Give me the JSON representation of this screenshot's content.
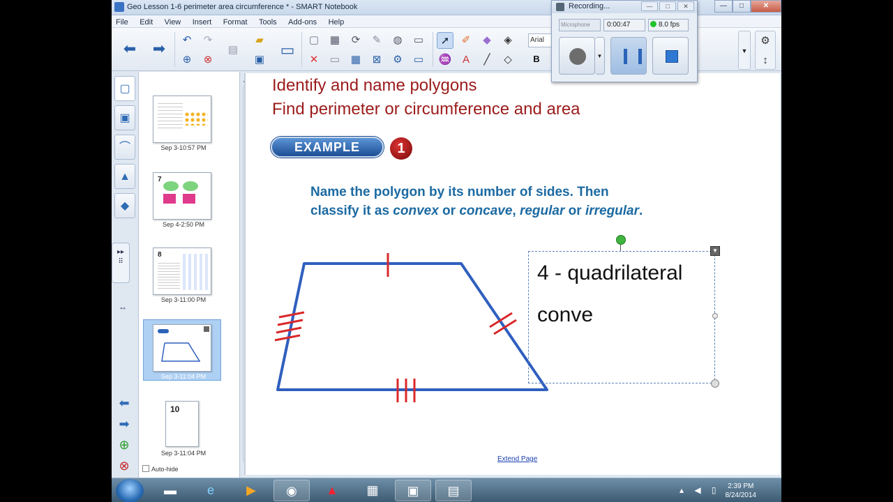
{
  "window": {
    "title": "Geo Lesson 1-6 perimeter area circumference * - SMART Notebook",
    "buttons": [
      "—",
      "□",
      "✕"
    ]
  },
  "menu": [
    "File",
    "Edit",
    "View",
    "Insert",
    "Format",
    "Tools",
    "Add-ons",
    "Help"
  ],
  "toolbar": {
    "font_name": "Arial",
    "bold_label": "B"
  },
  "recorder": {
    "title": "Recording...",
    "source_placeholder": "Microphone",
    "elapsed": "0:00:47",
    "fps": "8.0 fps",
    "buttons": [
      "—",
      "□",
      "✕"
    ]
  },
  "pages": [
    {
      "caption": "Sep 3-10:57 PM",
      "number": ""
    },
    {
      "caption": "Sep 4-2:50 PM",
      "number": "7"
    },
    {
      "caption": "Sep 3-11:00 PM",
      "number": "8"
    },
    {
      "caption": "Sep 3-11:04 PM",
      "number": ""
    },
    {
      "caption": "Sep 3-11:04 PM",
      "number": "10"
    }
  ],
  "sidebar": {
    "autohide_label": "Auto-hide"
  },
  "slide": {
    "title1": "Identify and name polygons",
    "title2": "Find perimeter or circumference and area",
    "example_label": "EXAMPLE",
    "example_number": "1",
    "question_line1": "Name the polygon by its number of sides. Then",
    "question_line2_a": "classify it as ",
    "question_convex": "convex",
    "question_or1": " or ",
    "question_concave": "concave",
    "question_comma": ", ",
    "question_regular": "regular",
    "question_or2": " or ",
    "question_irregular": "irregular",
    "question_end": ".",
    "answer_line1": "4 - quadrilateral",
    "answer_line2": "conve",
    "extend_link": "Extend Page",
    "shape_color": "#2f5fbf",
    "tick_color": "#d9282a"
  },
  "taskbar": {
    "time": "2:39 PM",
    "date": "8/24/2014"
  }
}
